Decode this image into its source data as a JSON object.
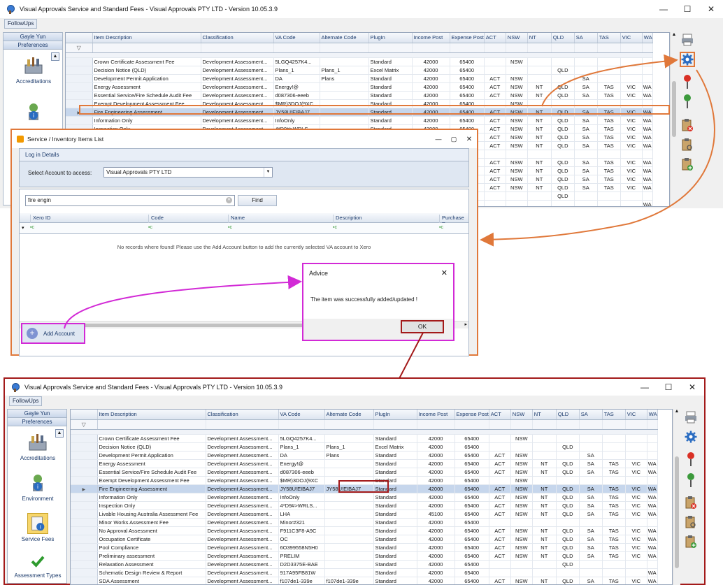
{
  "app": {
    "title": "Visual Approvals Service and Standard Fees - Visual Approvals PTY LTD - Version 10.05.3.9",
    "minimize": "—",
    "maximize": "☐",
    "close": "✕",
    "followups_label": "FollowUps"
  },
  "sidebar": {
    "user": "Gayle Yun",
    "preferences": "Preferences",
    "items": [
      "Accreditations",
      "Environment",
      "Service Fees",
      "Assessment Types"
    ]
  },
  "grid": {
    "columns": [
      "Item Description",
      "Classification",
      "VA Code",
      "Alternate Code",
      "PlugIn",
      "Income Post",
      "Expense Post",
      "ACT",
      "NSW",
      "NT",
      "QLD",
      "SA",
      "TAS",
      "VIC",
      "WA"
    ],
    "rows_top": [
      [
        "Crown Certificate Assessment Fee",
        "Development Assessment...",
        "5LGQ4257K4...",
        "",
        "Standard",
        "42000",
        "65400",
        "",
        "NSW",
        "",
        "",
        "",
        "",
        "",
        ""
      ],
      [
        "Decision Notice (QLD)",
        "Development Assessment...",
        "Plans_1",
        "Plans_1",
        "Excel Matrix",
        "42000",
        "65400",
        "",
        "",
        "",
        "QLD",
        "",
        "",
        "",
        ""
      ],
      [
        "Development Permit Application",
        "Development Assessment...",
        "DA",
        "Plans",
        "Standard",
        "42000",
        "65400",
        "ACT",
        "NSW",
        "",
        "",
        "SA",
        "",
        "",
        ""
      ],
      [
        "Energy Assessment",
        "Development Assessment...",
        "Energy!@",
        "",
        "Standard",
        "42000",
        "65400",
        "ACT",
        "NSW",
        "NT",
        "QLD",
        "SA",
        "TAS",
        "VIC",
        "WA"
      ],
      [
        "Essential Service/Fire Schedule Audit Fee",
        "Development Assessment...",
        "d087306-eeeb",
        "",
        "Standard",
        "42000",
        "65400",
        "ACT",
        "NSW",
        "NT",
        "QLD",
        "SA",
        "TAS",
        "VIC",
        "WA"
      ],
      [
        "Exempt Development Assessment Fee",
        "Development Assessment...",
        "$MR)3DOJ(9XC",
        "",
        "Standard",
        "42000",
        "65400",
        "",
        "NSW",
        "",
        "",
        "",
        "",
        "",
        ""
      ],
      [
        "Fire Engineering Assessment",
        "Development Assessment...",
        "JY58U!EIBAJ7",
        "",
        "Standard",
        "42000",
        "65400",
        "ACT",
        "NSW",
        "NT",
        "QLD",
        "SA",
        "TAS",
        "VIC",
        "WA"
      ],
      [
        "Information Only",
        "Development Assessment...",
        "InfoOnly",
        "",
        "Standard",
        "42000",
        "65400",
        "ACT",
        "NSW",
        "NT",
        "QLD",
        "SA",
        "TAS",
        "VIC",
        "WA"
      ],
      [
        "Inspection Only",
        "Development Assessment...",
        "4*D9#>WRLS...",
        "",
        "Standard",
        "42000",
        "65400",
        "ACT",
        "NSW",
        "NT",
        "QLD",
        "SA",
        "TAS",
        "VIC",
        "WA"
      ]
    ],
    "rows_top_hidden_states": [
      [
        "ACT",
        "NSW",
        "NT",
        "QLD",
        "SA",
        "TAS",
        "VIC",
        "WA"
      ],
      [
        "ACT",
        "NSW",
        "NT",
        "QLD",
        "SA",
        "TAS",
        "VIC",
        "WA"
      ],
      [
        "",
        "",
        "",
        "",
        "",
        "",
        "",
        ""
      ],
      [
        "ACT",
        "NSW",
        "NT",
        "QLD",
        "SA",
        "TAS",
        "VIC",
        "WA"
      ],
      [
        "ACT",
        "NSW",
        "NT",
        "QLD",
        "SA",
        "TAS",
        "VIC",
        "WA"
      ],
      [
        "ACT",
        "NSW",
        "NT",
        "QLD",
        "SA",
        "TAS",
        "VIC",
        "WA"
      ],
      [
        "ACT",
        "NSW",
        "NT",
        "QLD",
        "SA",
        "TAS",
        "VIC",
        "WA"
      ],
      [
        "",
        "",
        "",
        "QLD",
        "",
        "",
        "",
        ""
      ],
      [
        "",
        "",
        "",
        "",
        "",
        "",
        "",
        "WA"
      ],
      [
        "ACT",
        "NSW",
        "NT",
        "QLD",
        "SA",
        "TAS",
        "VIC",
        "WA"
      ]
    ],
    "rows_bottom": [
      [
        "Crown Certificate Assessment Fee",
        "Development Assessment...",
        "5LGQ4257K4...",
        "",
        "Standard",
        "42000",
        "65400",
        "",
        "NSW",
        "",
        "",
        "",
        "",
        "",
        ""
      ],
      [
        "Decision Notice (QLD)",
        "Development Assessment...",
        "Plans_1",
        "Plans_1",
        "Excel Matrix",
        "42000",
        "65400",
        "",
        "",
        "",
        "QLD",
        "",
        "",
        "",
        ""
      ],
      [
        "Development Permit Application",
        "Development Assessment...",
        "DA",
        "Plans",
        "Standard",
        "42000",
        "65400",
        "ACT",
        "NSW",
        "",
        "",
        "SA",
        "",
        "",
        ""
      ],
      [
        "Energy Assessment",
        "Development Assessment...",
        "Energy!@",
        "",
        "Standard",
        "42000",
        "65400",
        "ACT",
        "NSW",
        "NT",
        "QLD",
        "SA",
        "TAS",
        "VIC",
        "WA"
      ],
      [
        "Essential Service/Fire Schedule Audit Fee",
        "Development Assessment...",
        "d087306-eeeb",
        "",
        "Standard",
        "42000",
        "65400",
        "ACT",
        "NSW",
        "NT",
        "QLD",
        "SA",
        "TAS",
        "VIC",
        "WA"
      ],
      [
        "Exempt Development Assessment Fee",
        "Development Assessment...",
        "$MR)3DOJ(9XC",
        "",
        "Standard",
        "42000",
        "65400",
        "",
        "NSW",
        "",
        "",
        "",
        "",
        "",
        ""
      ],
      [
        "Fire Engineering Assessment",
        "Development Assessment...",
        "JY58U!EIBAJ7",
        "JY58U!EIBAJ7",
        "Standard",
        "42000",
        "65400",
        "ACT",
        "NSW",
        "NT",
        "QLD",
        "SA",
        "TAS",
        "VIC",
        "WA"
      ],
      [
        "Information Only",
        "Development Assessment...",
        "InfoOnly",
        "",
        "Standard",
        "42000",
        "65400",
        "ACT",
        "NSW",
        "NT",
        "QLD",
        "SA",
        "TAS",
        "VIC",
        "WA"
      ],
      [
        "Inspection Only",
        "Development Assessment...",
        "4*D9#>WRLS...",
        "",
        "Standard",
        "42000",
        "65400",
        "ACT",
        "NSW",
        "NT",
        "QLD",
        "SA",
        "TAS",
        "VIC",
        "WA"
      ],
      [
        "Livable Housing Australia Assessment Fee",
        "Development Assessment...",
        "LHA",
        "",
        "Standard",
        "45100",
        "65400",
        "ACT",
        "NSW",
        "NT",
        "QLD",
        "SA",
        "TAS",
        "VIC",
        "WA"
      ],
      [
        "Minor Works Assessment Fee",
        "Development Assessment...",
        "Minor#321",
        "",
        "Standard",
        "42000",
        "65400",
        "",
        "",
        "",
        "",
        "",
        "",
        "",
        ""
      ],
      [
        "No Approval Assessment",
        "Development Assessment...",
        "F911C3F8-A9C",
        "",
        "Standard",
        "42000",
        "65400",
        "ACT",
        "NSW",
        "NT",
        "QLD",
        "SA",
        "TAS",
        "VIC",
        "WA"
      ],
      [
        "Occupation Certificate",
        "Development Assessment...",
        "OC",
        "",
        "Standard",
        "42000",
        "65400",
        "ACT",
        "NSW",
        "NT",
        "QLD",
        "SA",
        "TAS",
        "VIC",
        "WA"
      ],
      [
        "Pool Compliance",
        "Development Assessment...",
        "6O399558N5H0",
        "",
        "Standard",
        "42000",
        "65400",
        "ACT",
        "NSW",
        "NT",
        "QLD",
        "SA",
        "TAS",
        "VIC",
        "WA"
      ],
      [
        "Preliminary assessment",
        "Development Assessment...",
        "PRELIM",
        "",
        "Standard",
        "42000",
        "65400",
        "ACT",
        "NSW",
        "NT",
        "QLD",
        "SA",
        "TAS",
        "VIC",
        "WA"
      ],
      [
        "Relaxation Assessment",
        "Development Assessment...",
        "D2D3375E-BAE",
        "",
        "Standard",
        "42000",
        "65400",
        "",
        "",
        "",
        "QLD",
        "",
        "",
        "",
        ""
      ],
      [
        "Schematic Design Review & Report",
        "Development Assessment...",
        "917A95FB81W",
        "",
        "Standard",
        "42000",
        "65400",
        "",
        "",
        "",
        "",
        "",
        "",
        "",
        "WA"
      ],
      [
        "SDA Assessment",
        "Development Assessment...",
        "f107de1-339e",
        "f107de1-339e",
        "Standard",
        "42000",
        "65400",
        "ACT",
        "NSW",
        "NT",
        "QLD",
        "SA",
        "TAS",
        "VIC",
        "WA"
      ]
    ]
  },
  "dialog": {
    "title": "Service / Inventory Items List",
    "section": "Log in Details",
    "account_label": "Select Account to access:",
    "account_value": "Visual Approvals PTY LTD",
    "search_value": "fire engin",
    "find_label": "Find",
    "columns": [
      "Xero ID",
      "Code",
      "Name",
      "Description",
      "Purchase De"
    ],
    "empty_message": "No records where found! Please use the Add Account button to add the currently selected VA account to Xero",
    "add_account_label": "Add Account"
  },
  "advice": {
    "title": "Advice",
    "message": "The item was successfully added/updated !",
    "ok_label": "OK",
    "close": "✕"
  },
  "colors": {
    "orange_callout": "#e0783a",
    "magenta_callout": "#d22ad6",
    "red_callout": "#a31a1a",
    "selected_row": "#c6d6ec"
  }
}
